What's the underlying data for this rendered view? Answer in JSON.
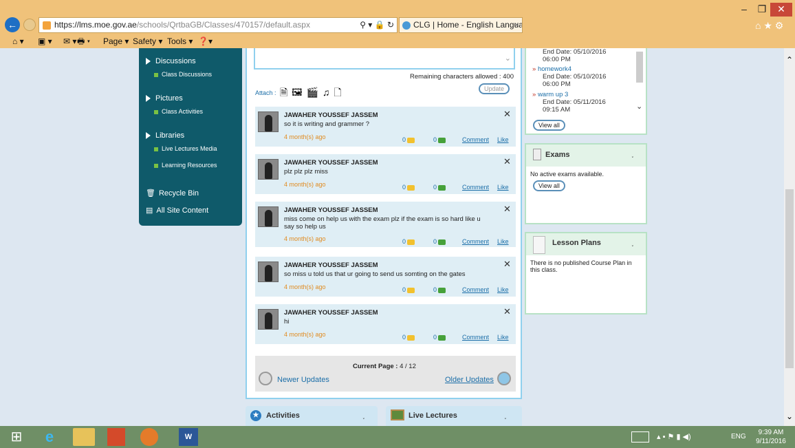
{
  "browser": {
    "url_host": "https://lms.moe.gov.ae",
    "url_path": "/schools/QrtbaGB/Classes/470157/default.aspx",
    "search_glyph": "⚲ ▾ 🔒 ↻",
    "tab_title": "CLG | Home - English Langua...",
    "tab_close": "×",
    "minimize": "–",
    "maximize": "❐",
    "close": "✕"
  },
  "commandbar": {
    "page": "Page ▾",
    "safety": "Safety ▾",
    "tools": "Tools ▾"
  },
  "nav": {
    "discussions": "Discussions",
    "class_discussions": "Class Discussions",
    "pictures": "Pictures",
    "class_activities": "Class Activities",
    "libraries": "Libraries",
    "live_lectures_media": "Live Lectures Media",
    "learning_resources": "Learning Resources",
    "recycle_bin": "Recycle Bin",
    "all_site_content": "All Site Content"
  },
  "composer": {
    "remaining": "Remaining characters allowed : 400",
    "attach": "Attach :",
    "update": "Update"
  },
  "posts": [
    {
      "name": "JAWAHER YOUSSEF JASSEM",
      "text": "so it is writing and grammer ?",
      "time": "4 month(s) ago",
      "comments": "0",
      "likes": "0",
      "comment": "Comment",
      "like": "Like"
    },
    {
      "name": "JAWAHER YOUSSEF JASSEM",
      "text": "plz plz plz miss",
      "time": "4 month(s) ago",
      "comments": "0",
      "likes": "0",
      "comment": "Comment",
      "like": "Like"
    },
    {
      "name": "JAWAHER YOUSSEF JASSEM",
      "text": "miss come on help us with the exam plz if the exam is so hard like u say so help us",
      "time": "4 month(s) ago",
      "comments": "0",
      "likes": "0",
      "comment": "Comment",
      "like": "Like"
    },
    {
      "name": "JAWAHER YOUSSEF JASSEM",
      "text": "so miss u told us that ur going to send us somting on the gates",
      "time": "4 month(s) ago",
      "comments": "0",
      "likes": "0",
      "comment": "Comment",
      "like": "Like"
    },
    {
      "name": "JAWAHER YOUSSEF JASSEM",
      "text": "hi",
      "time": "4 month(s) ago",
      "comments": "0",
      "likes": "0",
      "comment": "Comment",
      "like": "Like"
    }
  ],
  "pager": {
    "label": "Current Page :",
    "value": "4 / 12",
    "newer": "Newer Updates",
    "older": "Older Updates"
  },
  "assignments": {
    "end0": "End Date: 05/10/2016",
    "time0": "06:00 PM",
    "item1": "homework4",
    "end1": "End Date: 05/10/2016",
    "time1": "06:00 PM",
    "item2": "warm up 3",
    "end2": "End Date: 05/11/2016",
    "time2": "09:15 AM",
    "view_all": "View all"
  },
  "exams": {
    "title": "Exams",
    "empty": "No active exams available.",
    "view_all": "View all"
  },
  "lesson_plans": {
    "title": "Lesson Plans",
    "empty": "There is no published Course Plan in this class."
  },
  "panels": {
    "activities": "Activities",
    "live_lectures": "Live Lectures"
  },
  "taskbar": {
    "lang": "ENG",
    "time": "9:39 AM",
    "date": "9/11/2016"
  }
}
